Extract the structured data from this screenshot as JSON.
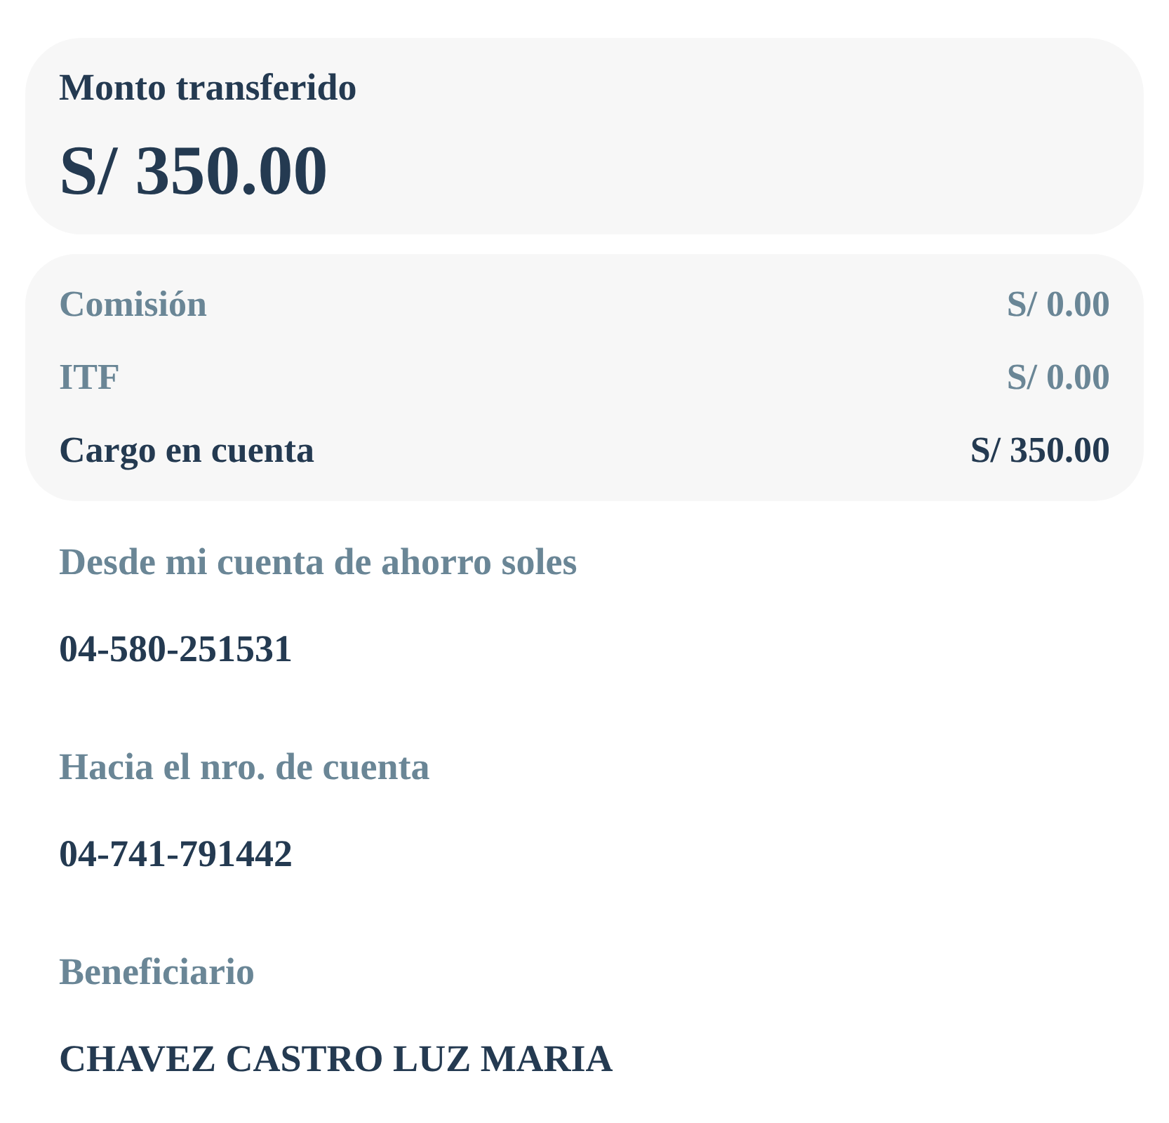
{
  "amount_card": {
    "label": "Monto transferido",
    "amount": "S/ 350.00"
  },
  "charges": [
    {
      "kind": "fee",
      "label": "Comisión",
      "value": "S/ 0.00"
    },
    {
      "kind": "fee",
      "label": "ITF",
      "value": "S/ 0.00"
    },
    {
      "kind": "total",
      "label": "Cargo en cuenta",
      "value": "S/ 350.00"
    }
  ],
  "details": [
    {
      "label": "Desde mi cuenta de ahorro soles",
      "value": "04-580-251531"
    },
    {
      "label": "Hacia el nro. de cuenta",
      "value": "04-741-791442"
    },
    {
      "label": "Beneficiario",
      "value": "CHAVEZ CASTRO LUZ MARIA"
    }
  ]
}
